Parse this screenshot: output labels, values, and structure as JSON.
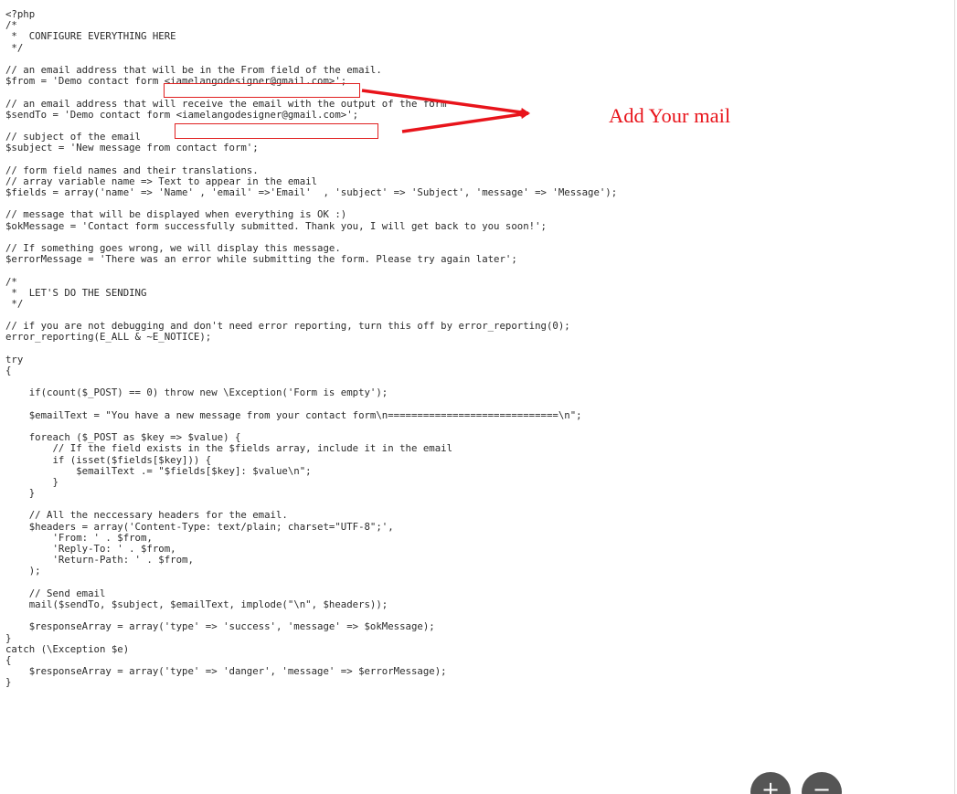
{
  "code_lines": [
    "<?php",
    "/*",
    " *  CONFIGURE EVERYTHING HERE",
    " */",
    "",
    "// an email address that will be in the From field of the email.",
    "$from = 'Demo contact form <iamelangodesigner@gmail.com>';",
    "",
    "// an email address that will receive the email with the output of the form",
    "$sendTo = 'Demo contact form <iamelangodesigner@gmail.com>';",
    "",
    "// subject of the email",
    "$subject = 'New message from contact form';",
    "",
    "// form field names and their translations.",
    "// array variable name => Text to appear in the email",
    "$fields = array('name' => 'Name' , 'email' =>'Email'  , 'subject' => 'Subject', 'message' => 'Message');",
    "",
    "// message that will be displayed when everything is OK :)",
    "$okMessage = 'Contact form successfully submitted. Thank you, I will get back to you soon!';",
    "",
    "// If something goes wrong, we will display this message.",
    "$errorMessage = 'There was an error while submitting the form. Please try again later';",
    "",
    "/*",
    " *  LET'S DO THE SENDING",
    " */",
    "",
    "// if you are not debugging and don't need error reporting, turn this off by error_reporting(0);",
    "error_reporting(E_ALL & ~E_NOTICE);",
    "",
    "try",
    "{",
    "",
    "    if(count($_POST) == 0) throw new \\Exception('Form is empty');",
    "",
    "    $emailText = \"You have a new message from your contact form\\n=============================\\n\";",
    "",
    "    foreach ($_POST as $key => $value) {",
    "        // If the field exists in the $fields array, include it in the email",
    "        if (isset($fields[$key])) {",
    "            $emailText .= \"$fields[$key]: $value\\n\";",
    "        }",
    "    }",
    "",
    "    // All the neccessary headers for the email.",
    "    $headers = array('Content-Type: text/plain; charset=\"UTF-8\";',",
    "        'From: ' . $from,",
    "        'Reply-To: ' . $from,",
    "        'Return-Path: ' . $from,",
    "    );",
    "",
    "    // Send email",
    "    mail($sendTo, $subject, $emailText, implode(\"\\n\", $headers));",
    "",
    "    $responseArray = array('type' => 'success', 'message' => $okMessage);",
    "}",
    "catch (\\Exception $e)",
    "{",
    "    $responseArray = array('type' => 'danger', 'message' => $errorMessage);",
    "}"
  ],
  "annotation": {
    "text": "Add Your mail",
    "color": "#e8141b"
  },
  "icons": {
    "zoom_in": "plus-icon",
    "zoom_out": "minus-icon"
  },
  "zoom_in_glyph": "+",
  "zoom_out_glyph": "−"
}
